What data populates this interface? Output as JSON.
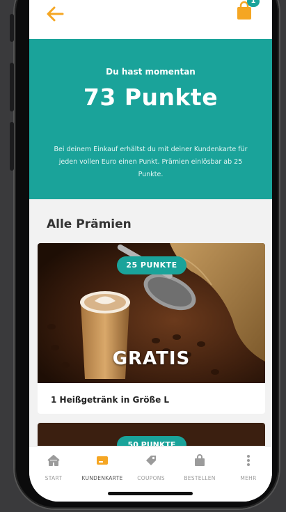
{
  "header": {
    "cart_count": "1"
  },
  "hero": {
    "intro": "Du hast momentan",
    "points": "73 Punkte",
    "description": "Bei deinem Einkauf erhältst du mit deiner Kundenkarte für jeden vollen Euro einen Punkt. Prämien einlösbar ab 25 Punkte."
  },
  "rewards": {
    "section_title": "Alle Prämien",
    "items": [
      {
        "points_badge": "25 PUNKTE",
        "overlay_text": "GRATIS",
        "title": "1 Heißgetränk in Größe L"
      },
      {
        "points_badge": "50 PUNKTE"
      }
    ]
  },
  "tabs": [
    {
      "label": "START",
      "icon": "home-icon"
    },
    {
      "label": "KUNDENKARTE",
      "icon": "card-icon",
      "active": true
    },
    {
      "label": "COUPONS",
      "icon": "tag-icon"
    },
    {
      "label": "BESTELLEN",
      "icon": "bag-icon"
    },
    {
      "label": "MEHR",
      "icon": "more-icon"
    }
  ],
  "colors": {
    "accent": "#f5a623",
    "teal": "#1aa39a"
  }
}
